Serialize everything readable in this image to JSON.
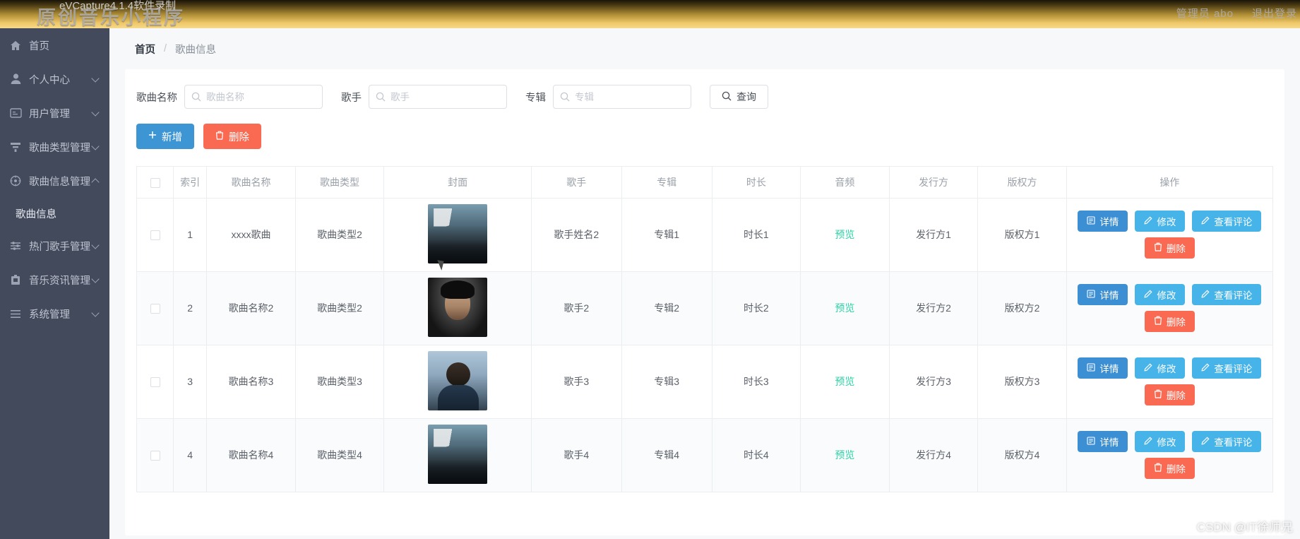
{
  "banner": {
    "recorder_label": "eVCapture4.1.4软件录制",
    "app_title": "原创音乐小程序",
    "user": "管理员 abo",
    "logout": "退出登录"
  },
  "sidebar": {
    "items": [
      {
        "label": "首页",
        "icon": "home-icon",
        "expandable": false,
        "expanded": false
      },
      {
        "label": "个人中心",
        "icon": "user-icon",
        "expandable": true,
        "expanded": false
      },
      {
        "label": "用户管理",
        "icon": "id-card-icon",
        "expandable": true,
        "expanded": false
      },
      {
        "label": "歌曲类型管理",
        "icon": "filter-icon",
        "expandable": true,
        "expanded": false
      },
      {
        "label": "歌曲信息管理",
        "icon": "disc-icon",
        "expandable": true,
        "expanded": true
      },
      {
        "label": "热门歌手管理",
        "icon": "sliders-icon",
        "expandable": true,
        "expanded": false
      },
      {
        "label": "音乐资讯管理",
        "icon": "news-icon",
        "expandable": true,
        "expanded": false
      },
      {
        "label": "系统管理",
        "icon": "menu-icon",
        "expandable": true,
        "expanded": false
      }
    ],
    "submenu": {
      "label": "歌曲信息",
      "parent": "歌曲信息管理"
    }
  },
  "breadcrumb": {
    "home": "首页",
    "separator": "/",
    "current": "歌曲信息"
  },
  "search": {
    "fields": [
      {
        "label": "歌曲名称",
        "placeholder": "歌曲名称",
        "value": ""
      },
      {
        "label": "歌手",
        "placeholder": "歌手",
        "value": ""
      },
      {
        "label": "专辑",
        "placeholder": "专辑",
        "value": ""
      }
    ],
    "query_button": "查询"
  },
  "toolbar": {
    "add_label": "新增",
    "delete_label": "删除"
  },
  "table": {
    "columns": [
      "索引",
      "歌曲名称",
      "歌曲类型",
      "封面",
      "歌手",
      "专辑",
      "时长",
      "音频",
      "发行方",
      "版权方",
      "操作"
    ],
    "preview_label": "预览",
    "row_actions": [
      "详情",
      "修改",
      "查看评论",
      "删除"
    ],
    "rows": [
      {
        "index": "1",
        "name": "xxxx歌曲",
        "type": "歌曲类型2",
        "cover": "cover-a",
        "singer": "歌手姓名2",
        "album": "专辑1",
        "duration": "时长1",
        "audio": "预览",
        "publisher": "发行方1",
        "copyright": "版权方1"
      },
      {
        "index": "2",
        "name": "歌曲名称2",
        "type": "歌曲类型2",
        "cover": "cover-b",
        "singer": "歌手2",
        "album": "专辑2",
        "duration": "时长2",
        "audio": "预览",
        "publisher": "发行方2",
        "copyright": "版权方2"
      },
      {
        "index": "3",
        "name": "歌曲名称3",
        "type": "歌曲类型3",
        "cover": "cover-c",
        "singer": "歌手3",
        "album": "专辑3",
        "duration": "时长3",
        "audio": "预览",
        "publisher": "发行方3",
        "copyright": "版权方3"
      },
      {
        "index": "4",
        "name": "歌曲名称4",
        "type": "歌曲类型4",
        "cover": "cover-a",
        "singer": "歌手4",
        "album": "专辑4",
        "duration": "时长4",
        "audio": "预览",
        "publisher": "发行方4",
        "copyright": "版权方4"
      }
    ]
  },
  "watermark": "CSDN @IT徐师兄",
  "colors": {
    "sidebar_bg": "#434a5c",
    "banner_gold": "#f0c96a",
    "primary_blue": "#3d95d4",
    "light_blue": "#46b4e8",
    "danger_red": "#fa6a52",
    "preview_green": "#2fd3a5"
  }
}
